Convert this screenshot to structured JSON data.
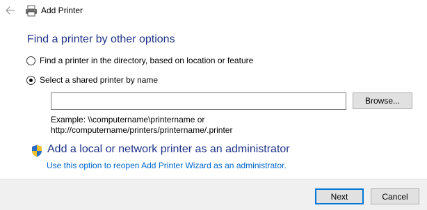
{
  "window": {
    "title": "Add Printer"
  },
  "main": {
    "heading": "Find a printer by other options",
    "options": [
      {
        "label": "Find a printer in the directory, based on location or feature",
        "selected": false
      },
      {
        "label": "Select a shared printer by name",
        "selected": true
      }
    ],
    "printer_name_value": "",
    "browse_label": "Browse...",
    "example_line1": "Example: \\\\computername\\printername or",
    "example_line2": "http://computername/printers/printername/.printer",
    "admin_link": "Add a local or network printer as an administrator",
    "admin_desc": "Use this option to reopen Add Printer Wizard as an administrator."
  },
  "footer": {
    "next_label": "Next",
    "cancel_label": "Cancel"
  }
}
